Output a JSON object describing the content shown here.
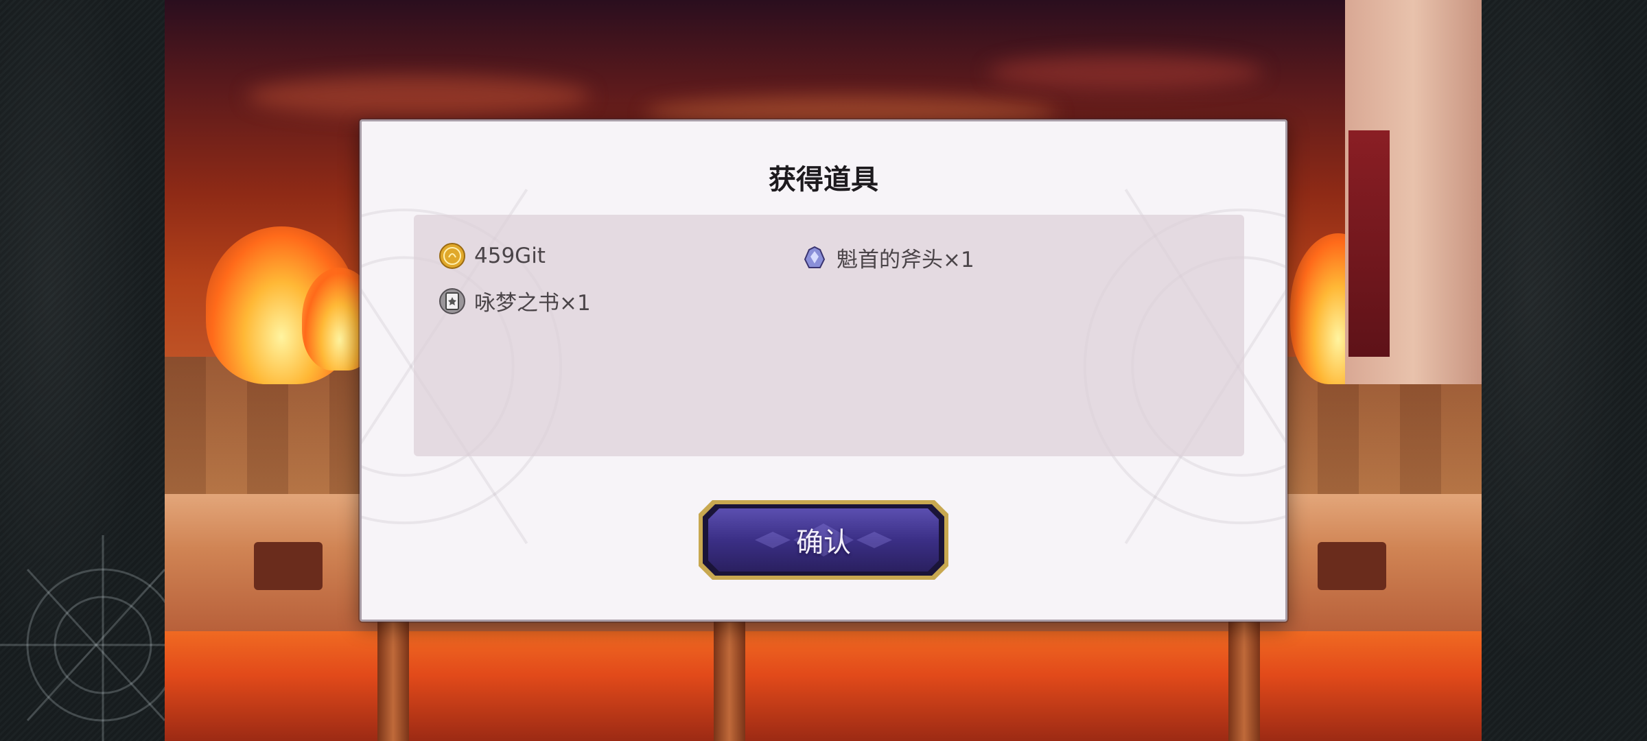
{
  "dialog": {
    "title": "获得道具",
    "confirm_label": "确认"
  },
  "rewards": [
    {
      "icon": "gold-coin-icon",
      "label": "459Git"
    },
    {
      "icon": "axe-head-icon",
      "label": "魁首的斧头×1"
    },
    {
      "icon": "book-icon",
      "label": "咏梦之书×1"
    }
  ],
  "colors": {
    "dialog_bg": "#f7f4f8",
    "panel_bg": "#dcd0d8",
    "button_fill": "#3b2f86",
    "button_border": "#c8a850",
    "coin": "#e0a82a"
  }
}
